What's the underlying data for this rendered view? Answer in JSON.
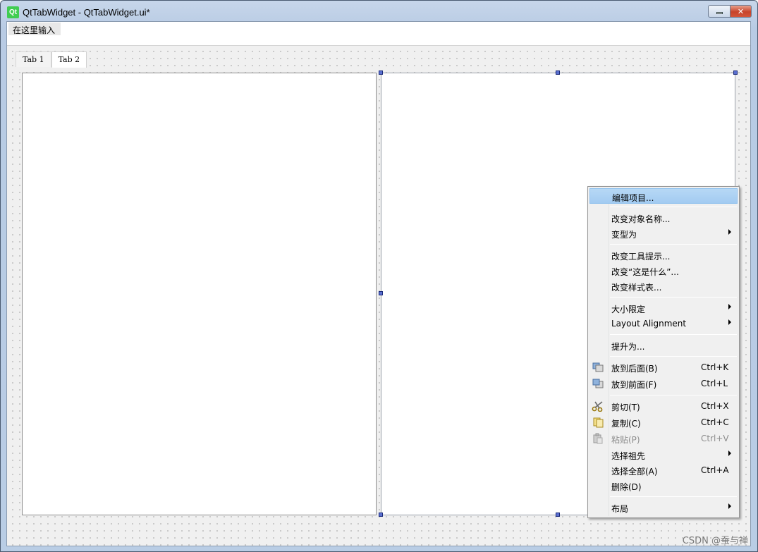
{
  "window": {
    "title": "QtTabWidget - QtTabWidget.ui*",
    "app_icon": "Qt",
    "minimize_icon": "minimize-icon",
    "close_icon": "close-icon",
    "close_glyph": "✕"
  },
  "menubar": {
    "placeholder_item": "在这里输入"
  },
  "tabs": [
    {
      "label": "Tab 1"
    },
    {
      "label": "Tab 2"
    }
  ],
  "context_menu": {
    "items": [
      {
        "label": "编辑项目...",
        "highlighted": true
      },
      {
        "label": "改变对象名称..."
      },
      {
        "label": "变型为",
        "submenu": true
      },
      {
        "label": "改变工具提示..."
      },
      {
        "label": "改变“这是什么”..."
      },
      {
        "label": "改变样式表..."
      },
      {
        "label": "大小限定",
        "submenu": true
      },
      {
        "label": "Layout Alignment",
        "submenu": true
      },
      {
        "label": "提升为..."
      },
      {
        "label": "放到后面(B)",
        "shortcut": "Ctrl+K",
        "icon": "send-to-back-icon"
      },
      {
        "label": "放到前面(F)",
        "shortcut": "Ctrl+L",
        "icon": "bring-to-front-icon"
      },
      {
        "label": "剪切(T)",
        "shortcut": "Ctrl+X",
        "icon": "scissors-icon"
      },
      {
        "label": "复制(C)",
        "shortcut": "Ctrl+C",
        "icon": "copy-icon"
      },
      {
        "label": "粘贴(P)",
        "shortcut": "Ctrl+V",
        "icon": "paste-icon",
        "disabled": true
      },
      {
        "label": "选择祖先",
        "submenu": true
      },
      {
        "label": "选择全部(A)",
        "shortcut": "Ctrl+A"
      },
      {
        "label": "删除(D)"
      },
      {
        "label": "布局",
        "submenu": true
      }
    ]
  },
  "watermark": "CSDN @蚕与禅",
  "colors": {
    "highlight": "#a2cbf1",
    "handle": "#5a6fd0",
    "qt_green": "#41cd52"
  }
}
